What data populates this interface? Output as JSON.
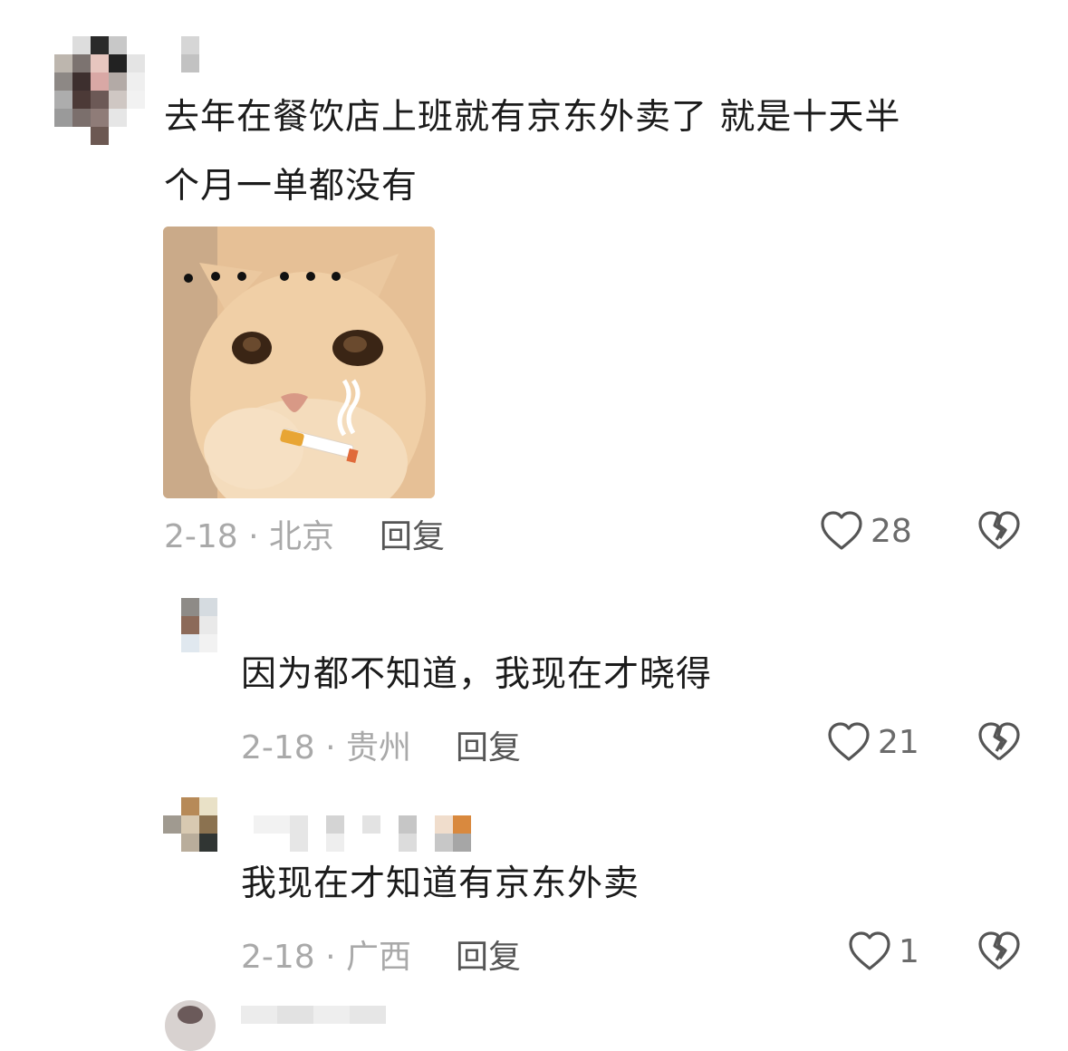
{
  "comments": [
    {
      "text_line1": "去年在餐饮店上班就有京东外卖了 就是十天半",
      "text_line2": "个月一单都没有",
      "date": "2-18",
      "location": "北京",
      "reply_label": "回复",
      "likes": "28",
      "sticker": {
        "dots": "• • •   • • •"
      }
    },
    {
      "text": "因为都不知道，我现在才晓得",
      "date": "2-18",
      "location": "贵州",
      "reply_label": "回复",
      "likes": "21"
    },
    {
      "text": "我现在才知道有京东外卖",
      "date": "2-18",
      "location": "广西",
      "reply_label": "回复",
      "likes": "1"
    }
  ],
  "colors": {
    "text": "#1b1b1b",
    "meta": "#a9a9a9",
    "reply": "#555555",
    "icon": "#555555"
  }
}
